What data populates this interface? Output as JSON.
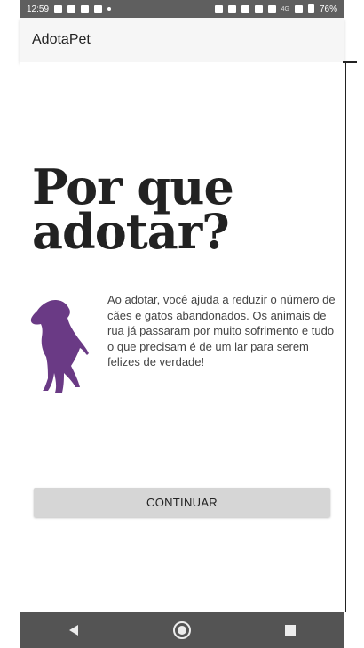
{
  "status_bar": {
    "time": "12:59",
    "network": "4G",
    "battery": "76%"
  },
  "app_bar": {
    "title": "AdotaPet"
  },
  "main": {
    "headline": "Por que adotar?",
    "image_icon": "dog-silhouette-icon",
    "description": "Ao adotar, você ajuda a reduzir o número de cães e gatos abandonados. Os animais de rua já passaram por muito sofrimento e tudo o que precisam é de um lar para serem felizes de verdade!",
    "continue_label": "CONTINUAR"
  },
  "nav_bar": {
    "back_icon": "back-triangle-icon",
    "home_icon": "home-circle-icon",
    "recents_icon": "recents-square-icon"
  },
  "colors": {
    "dog": "#6a3a85",
    "button": "#d6d6d6",
    "status_bar": "#5f5f5f",
    "nav_bar": "#545454"
  }
}
